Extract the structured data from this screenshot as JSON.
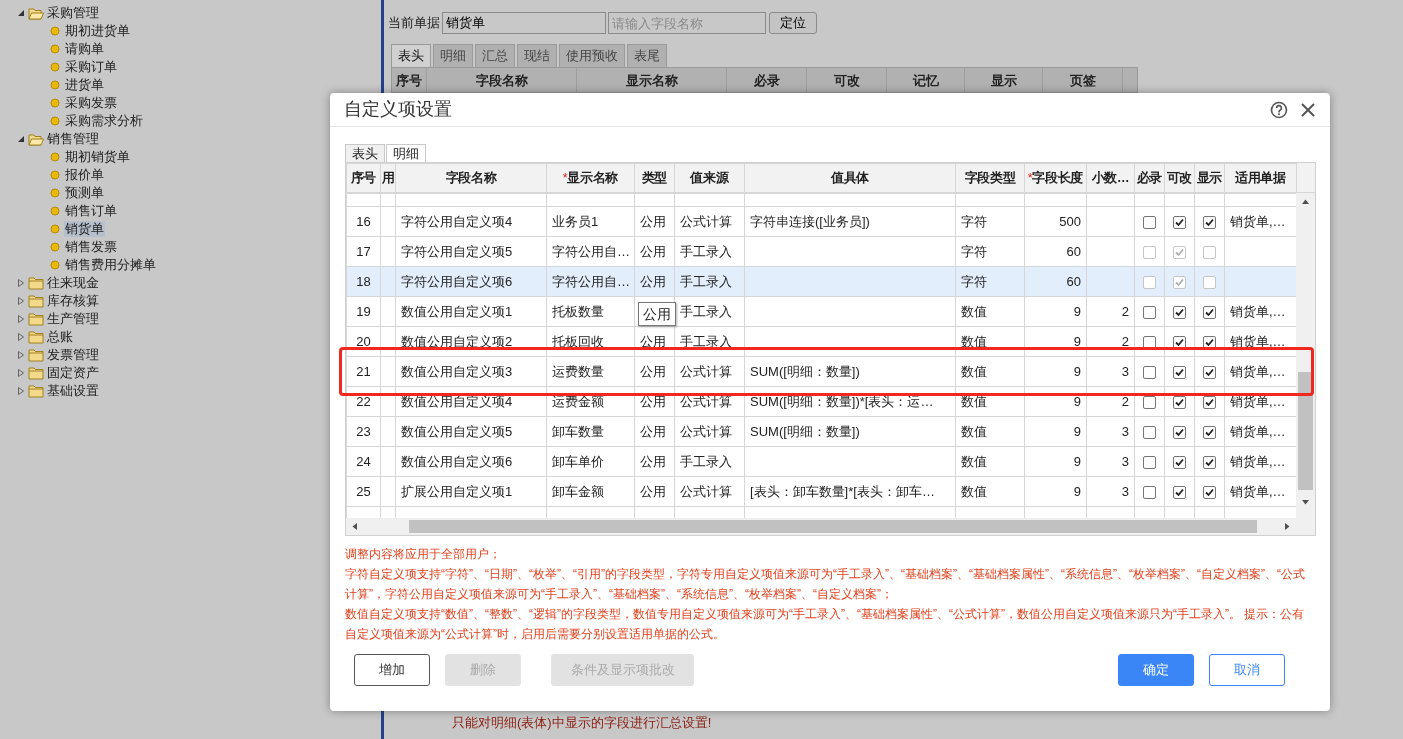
{
  "tree": [
    {
      "label": "采购管理",
      "expanded": true,
      "children": [
        {
          "label": "期初进货单",
          "selected": false
        },
        {
          "label": "请购单",
          "selected": false
        },
        {
          "label": "采购订单",
          "selected": false
        },
        {
          "label": "进货单",
          "selected": false
        },
        {
          "label": "采购发票",
          "selected": false
        },
        {
          "label": "采购需求分析",
          "selected": false
        }
      ]
    },
    {
      "label": "销售管理",
      "expanded": true,
      "children": [
        {
          "label": "期初销货单",
          "selected": false
        },
        {
          "label": "报价单",
          "selected": false
        },
        {
          "label": "预测单",
          "selected": false
        },
        {
          "label": "销售订单",
          "selected": false
        },
        {
          "label": "销货单",
          "selected": true
        },
        {
          "label": "销售发票",
          "selected": false
        },
        {
          "label": "销售费用分摊单",
          "selected": false
        }
      ]
    },
    {
      "label": "往来现金",
      "expanded": false
    },
    {
      "label": "库存核算",
      "expanded": false
    },
    {
      "label": "生产管理",
      "expanded": false
    },
    {
      "label": "总账",
      "expanded": false
    },
    {
      "label": "发票管理",
      "expanded": false
    },
    {
      "label": "固定资产",
      "expanded": false
    },
    {
      "label": "基础设置",
      "expanded": false
    }
  ],
  "document_bar": {
    "label": "当前单据",
    "value": "销货单",
    "search_placeholder": "请输入字段名称",
    "locate_button": "定位"
  },
  "bg_tabs": [
    {
      "label": "表头",
      "selected": true
    },
    {
      "label": "明细",
      "selected": false
    },
    {
      "label": "汇总",
      "selected": false
    },
    {
      "label": "现结",
      "selected": false
    },
    {
      "label": "使用预收",
      "selected": false
    },
    {
      "label": "表尾",
      "selected": false
    }
  ],
  "bg_table": {
    "columns": [
      "序号",
      "字段名称",
      "显示名称",
      "必录",
      "可改",
      "记忆",
      "显示",
      "页签"
    ]
  },
  "bg_message": "只能对明细(表体)中显示的字段进行汇总设置!",
  "dialog": {
    "title": "自定义项设置",
    "tabs": [
      {
        "label": "表头",
        "selected": true
      },
      {
        "label": "明细",
        "selected": false
      }
    ],
    "table": {
      "columns": [
        {
          "label": "序号"
        },
        {
          "label": "用"
        },
        {
          "label": "字段名称"
        },
        {
          "label": "显示名称",
          "mark": "*"
        },
        {
          "label": "类型"
        },
        {
          "label": "值来源"
        },
        {
          "label": "值具体"
        },
        {
          "label": "字段类型"
        },
        {
          "label": "字段长度",
          "mark": "*"
        },
        {
          "label": "小数…"
        },
        {
          "label": "必录"
        },
        {
          "label": "可改"
        },
        {
          "label": "显示"
        },
        {
          "label": "适用单据"
        }
      ],
      "rows": [
        {
          "no": "16",
          "field_name": "字符公用自定义项4",
          "display_name": "业务员1",
          "type": "公用",
          "source": "公式计算",
          "value": "字符串连接([业务员])",
          "field_type": "字符",
          "length": "500",
          "required": false,
          "editable": true,
          "shown": true,
          "locked": false,
          "applies_to": "销货单,…",
          "selected": false,
          "highlighted": false
        },
        {
          "no": "17",
          "field_name": "字符公用自定义项5",
          "display_name": "字符公用自…",
          "type": "公用",
          "source": "手工录入",
          "field_type": "字符",
          "length": "60",
          "required": false,
          "editable": true,
          "shown": false,
          "locked": true,
          "selected": false,
          "highlighted": false
        },
        {
          "no": "18",
          "field_name": "字符公用自定义项6",
          "display_name": "字符公用自…",
          "type": "公用",
          "source": "手工录入",
          "field_type": "字符",
          "length": "60",
          "required": false,
          "editable": true,
          "shown": false,
          "locked": true,
          "selected": true,
          "highlighted": false
        },
        {
          "no": "19",
          "field_name": "数值公用自定义项1",
          "display_name": "托板数量",
          "tooltip": "公用",
          "source": "手工录入",
          "field_type": "数值",
          "length": "9",
          "decimals": "2",
          "required": false,
          "editable": true,
          "shown": true,
          "locked": false,
          "applies_to": "销货单,…",
          "selected": false,
          "highlighted": false
        },
        {
          "no": "20",
          "field_name": "数值公用自定义项2",
          "display_name": "托板回收",
          "type": "公用",
          "source": "手工录入",
          "field_type": "数值",
          "length": "9",
          "decimals": "2",
          "required": false,
          "editable": true,
          "shown": true,
          "locked": false,
          "applies_to": "销货单,…",
          "selected": false,
          "highlighted": false
        },
        {
          "no": "21",
          "field_name": "数值公用自定义项3",
          "display_name": "运费数量",
          "type": "公用",
          "source": "公式计算",
          "value": "SUM([明细：数量])",
          "field_type": "数值",
          "length": "9",
          "decimals": "3",
          "required": false,
          "editable": true,
          "shown": true,
          "locked": false,
          "applies_to": "销货单,…",
          "selected": false,
          "highlighted": true
        },
        {
          "no": "22",
          "field_name": "数值公用自定义项4",
          "display_name": "运费金额",
          "type": "公用",
          "source": "公式计算",
          "value": "SUM([明细：数量])*[表头：运…",
          "field_type": "数值",
          "length": "9",
          "decimals": "2",
          "required": false,
          "editable": true,
          "shown": true,
          "locked": false,
          "applies_to": "销货单,…",
          "selected": false,
          "highlighted": false
        },
        {
          "no": "23",
          "field_name": "数值公用自定义项5",
          "display_name": "卸车数量",
          "type": "公用",
          "source": "公式计算",
          "value": "SUM([明细：数量])",
          "field_type": "数值",
          "length": "9",
          "decimals": "3",
          "required": false,
          "editable": true,
          "shown": true,
          "locked": false,
          "applies_to": "销货单,…",
          "selected": false,
          "highlighted": false
        },
        {
          "no": "24",
          "field_name": "数值公用自定义项6",
          "display_name": "卸车单价",
          "type": "公用",
          "source": "手工录入",
          "field_type": "数值",
          "length": "9",
          "decimals": "3",
          "required": false,
          "editable": true,
          "shown": true,
          "locked": false,
          "applies_to": "销货单,…",
          "selected": false,
          "highlighted": false
        },
        {
          "no": "25",
          "field_name": "扩展公用自定义项1",
          "display_name": "卸车金额",
          "type": "公用",
          "source": "公式计算",
          "value": "[表头：卸车数量]*[表头：卸车…",
          "field_type": "数值",
          "length": "9",
          "decimals": "3",
          "required": false,
          "editable": true,
          "shown": true,
          "locked": false,
          "applies_to": "销货单,…",
          "selected": false,
          "highlighted": false
        }
      ]
    },
    "notes": [
      "调整内容将应用于全部用户；",
      "字符自定义项支持“字符”、“日期”、“枚举”、“引用”的字段类型，字符专用自定义项值来源可为“手工录入”、“基础档案”、“基础档案属性”、“系统信息”、“枚举档案”、“自定义档案”、“公式计算”，字符公用自定义项值来源可为“手工录入”、“基础档案”、“系统信息”、“枚举档案”、“自定义档案”；",
      "数值自定义项支持“数值”、“整数”、“逻辑”的字段类型，数值专用自定义项值来源可为“手工录入”、“基础档案属性”、“公式计算”，数值公用自定义项值来源只为“手工录入”。 提示：公有自定义项值来源为“公式计算”时，启用后需要分别设置适用单据的公式。"
    ],
    "buttons": [
      {
        "label": "增加",
        "kind": "outline",
        "disabled": false
      },
      {
        "label": "删除",
        "kind": "plain",
        "disabled": true
      },
      {
        "label": "条件及显示项批改",
        "kind": "plain",
        "disabled": true
      },
      {
        "label": "确定",
        "kind": "primary",
        "disabled": false
      },
      {
        "label": "取消",
        "kind": "cancel",
        "disabled": false
      }
    ]
  }
}
